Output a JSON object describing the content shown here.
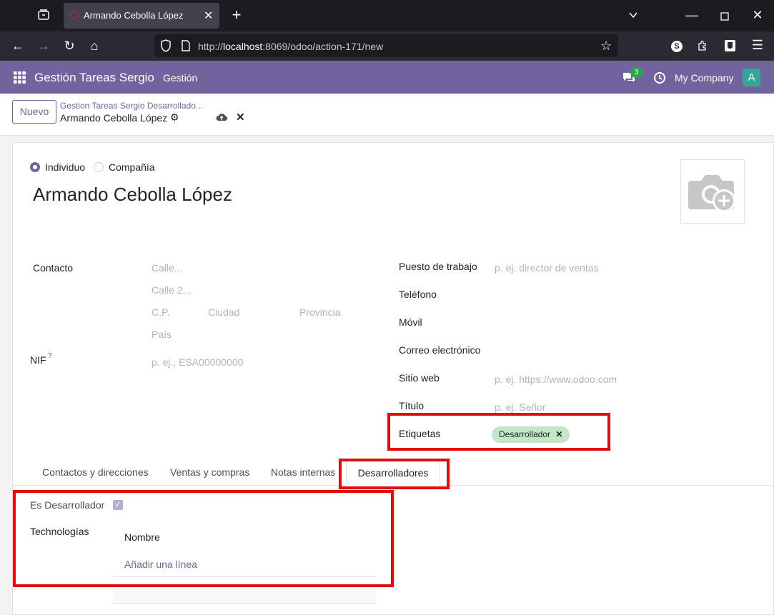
{
  "browser": {
    "tab_title": "Armando Cebolla López",
    "new_tab_icon": "+",
    "url_prefix": "http://",
    "url_host": "localhost",
    "url_rest": ":8069/odoo/action-171/new"
  },
  "topnav": {
    "app_name": "Gestión Tareas Sergio",
    "menu": "Gestión",
    "messages_count": "3",
    "company": "My Company",
    "avatar": "A",
    "accent": "#71639e"
  },
  "control_panel": {
    "new_button": "Nuevo",
    "breadcrumb_parent": "Gestion Tareas Sergio Desarrollado...",
    "breadcrumb_current": "Armando Cebolla López"
  },
  "form": {
    "type_options": [
      "Individuo",
      "Compañía"
    ],
    "selected_type": "Individuo",
    "name": "Armando Cebolla López",
    "left": {
      "contact_label": "Contacto",
      "street_ph": "Calle...",
      "street2_ph": "Calle 2...",
      "zip_ph": "C.P.",
      "city_ph": "Ciudad",
      "state_ph": "Provincia",
      "country_ph": "País",
      "vat_label": "NIF",
      "vat_help": "?",
      "vat_ph": "p. ej., ESA00000000"
    },
    "right": {
      "job_label": "Puesto de trabajo",
      "job_ph": "p. ej. director de ventas",
      "phone_label": "Teléfono",
      "mobile_label": "Móvil",
      "email_label": "Correo electrónico",
      "website_label": "Sitio web",
      "website_ph": "p. ej. https://www.odoo.com",
      "title_label": "Título",
      "title_ph": "p. ej. Señor",
      "tags_label": "Etiquetas",
      "tag": "Desarrollador"
    },
    "tabs": [
      "Contactos y direcciones",
      "Ventas y compras",
      "Notas internas",
      "Desarrolladores"
    ],
    "active_tab": "Desarrolladores",
    "dev": {
      "is_dev_label": "Es Desarrollador",
      "is_dev_checked": true,
      "tech_label": "Technologías",
      "column_name": "Nombre",
      "add_line": "Añadir una línea"
    }
  }
}
